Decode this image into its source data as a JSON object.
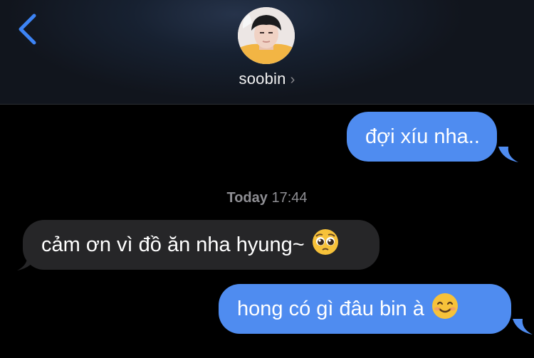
{
  "header": {
    "contact_name": "soobin",
    "chevron": "›",
    "back_icon": "chevron-left-icon"
  },
  "timestamp": {
    "day": "Today",
    "time": "17:44"
  },
  "messages": [
    {
      "direction": "outgoing",
      "text": "đợi xíu nha.."
    },
    {
      "direction": "incoming",
      "text": "cảm ơn vì đồ ăn nha hyung~",
      "emoji": "pleading-face-emoji"
    },
    {
      "direction": "outgoing",
      "text": "hong có gì đâu bin à",
      "emoji": "smiling-face-emoji"
    }
  ],
  "colors": {
    "outgoing_bubble": "#4f8cf0",
    "incoming_bubble": "#262628",
    "accent": "#3b82f6",
    "background": "#000000"
  }
}
